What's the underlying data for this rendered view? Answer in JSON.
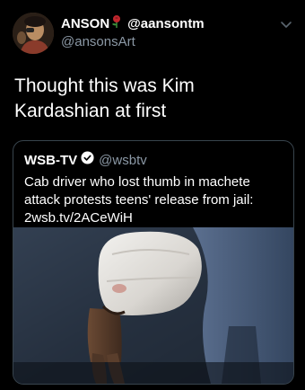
{
  "tweet": {
    "display_name": "ANSON",
    "inline_handle": "@aansontm",
    "handle": "@ansonsArt",
    "text": "Thought this was Kim Kardashian at first"
  },
  "quote": {
    "name": "WSB-TV",
    "handle": "@wsbtv",
    "text": "Cab driver who lost thumb in machete attack protests teens' release from jail: 2wsb.tv/2ACeWiH"
  },
  "colors": {
    "background": "#000000",
    "text": "#ffffff",
    "secondary_text": "#8b98a5",
    "card_border": "#38444d",
    "verified": "#ffffff"
  },
  "icons": {
    "rose": "rose-icon",
    "verified": "verified-check-icon",
    "chevron": "chevron-down-icon"
  }
}
